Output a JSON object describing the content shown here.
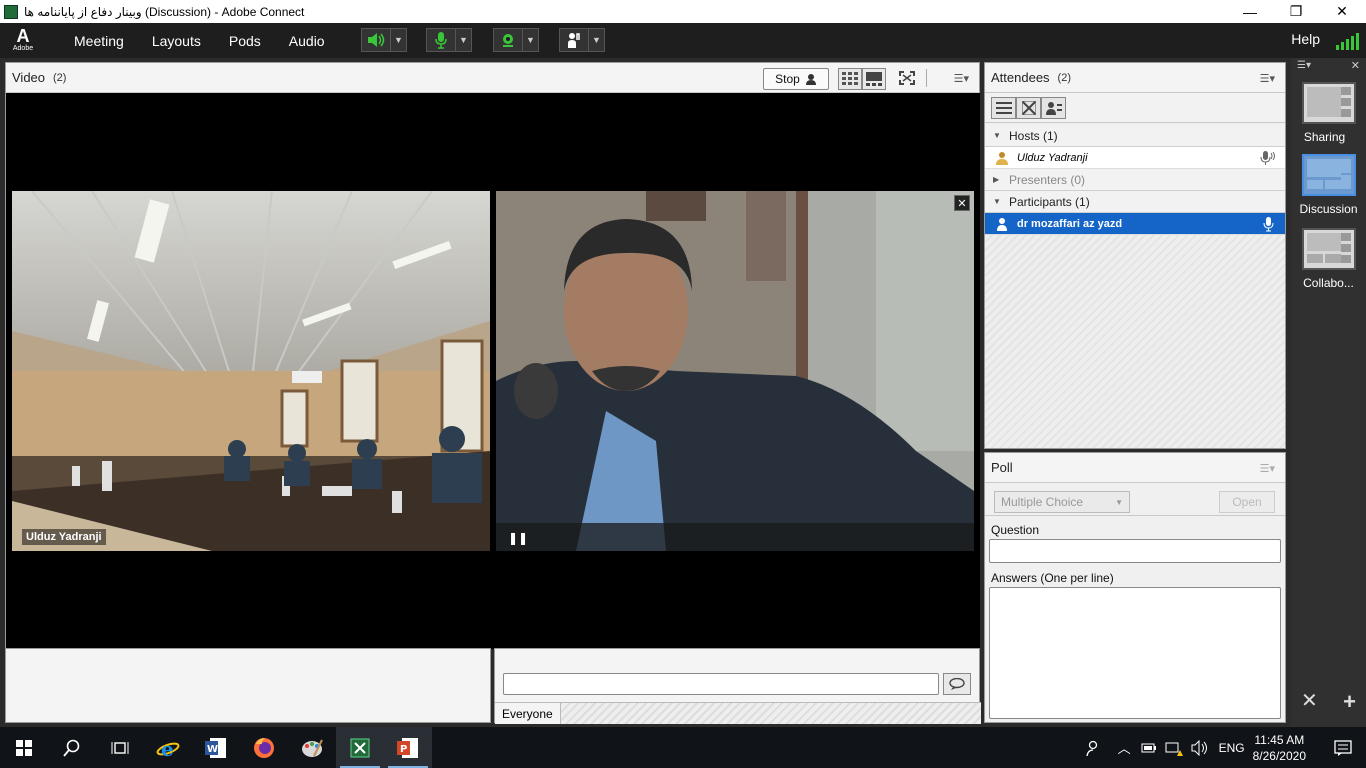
{
  "window": {
    "title": "وبینار دفاع از پایاننامه ها (Discussion) - Adobe Connect",
    "minimize": "—",
    "maximize": "❐",
    "close": "✕"
  },
  "menubar": {
    "logo_text": "Adobe",
    "items": [
      "Meeting",
      "Layouts",
      "Pods",
      "Audio"
    ],
    "help": "Help",
    "colors": {
      "green": "#39c639"
    }
  },
  "video_pod": {
    "title": "Video",
    "count": "(2)",
    "stop_label": "Stop",
    "tile1_label": "Ulduz Yadranji"
  },
  "chat": {
    "scope": "Everyone"
  },
  "attendees": {
    "title": "Attendees",
    "count": "(2)",
    "sections": {
      "hosts": "Hosts (1)",
      "presenters": "Presenters (0)",
      "participants": "Participants (1)"
    },
    "host_name": "Ulduz Yadranji",
    "participant_name": "dr mozaffari az yazd"
  },
  "poll": {
    "title": "Poll",
    "type_select": "Multiple Choice",
    "open_label": "Open",
    "question_label": "Question",
    "answers_label": "Answers (One per line)"
  },
  "layouts": {
    "items": [
      "Sharing",
      "Discussion",
      "Collabo..."
    ],
    "active": "Discussion"
  },
  "taskbar": {
    "tray_lang": "ENG",
    "time": "11:45 AM",
    "date": "8/26/2020"
  }
}
